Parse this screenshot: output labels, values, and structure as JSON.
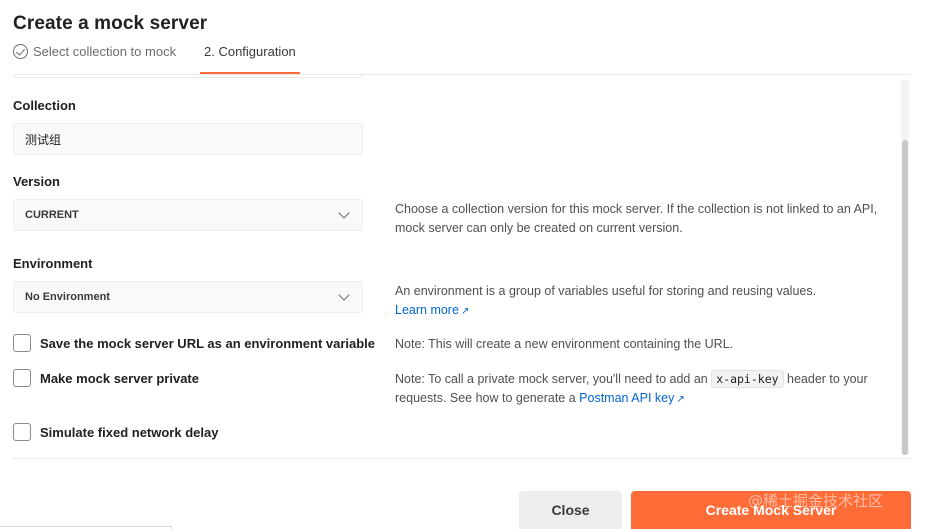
{
  "dialog": {
    "title": "Create a mock server"
  },
  "steps": [
    {
      "label": "Select collection to mock",
      "state": "done"
    },
    {
      "label": "2. Configuration",
      "state": "active"
    }
  ],
  "form": {
    "collection": {
      "label": "Collection",
      "value": "测试组"
    },
    "version": {
      "label": "Version",
      "value": "CURRENT",
      "help": "Choose a collection version for this mock server. If the collection is not linked to an API, mock server can only be created on current version."
    },
    "environment": {
      "label": "Environment",
      "value": "No Environment",
      "help": "An environment is a group of variables useful for storing and reusing values.",
      "learn_more": "Learn more"
    },
    "save_url": {
      "label": "Save the mock server URL as an environment variable",
      "checked": false,
      "help": "Note: This will create a new environment containing the URL."
    },
    "private": {
      "label": "Make mock server private",
      "checked": false,
      "help_before": "Note: To call a private mock server, you'll need to add an",
      "help_code": "x-api-key",
      "help_after": "header to your",
      "help_line2": "requests. See how to generate a",
      "help_link": "Postman API key"
    },
    "delay": {
      "label": "Simulate fixed network delay",
      "checked": false
    }
  },
  "footer": {
    "close_label": "Close",
    "create_label": "Create Mock Server"
  },
  "watermark": "@稀土掘金技术社区",
  "colors": {
    "accent": "#ff6c37",
    "link": "#0265d2"
  }
}
